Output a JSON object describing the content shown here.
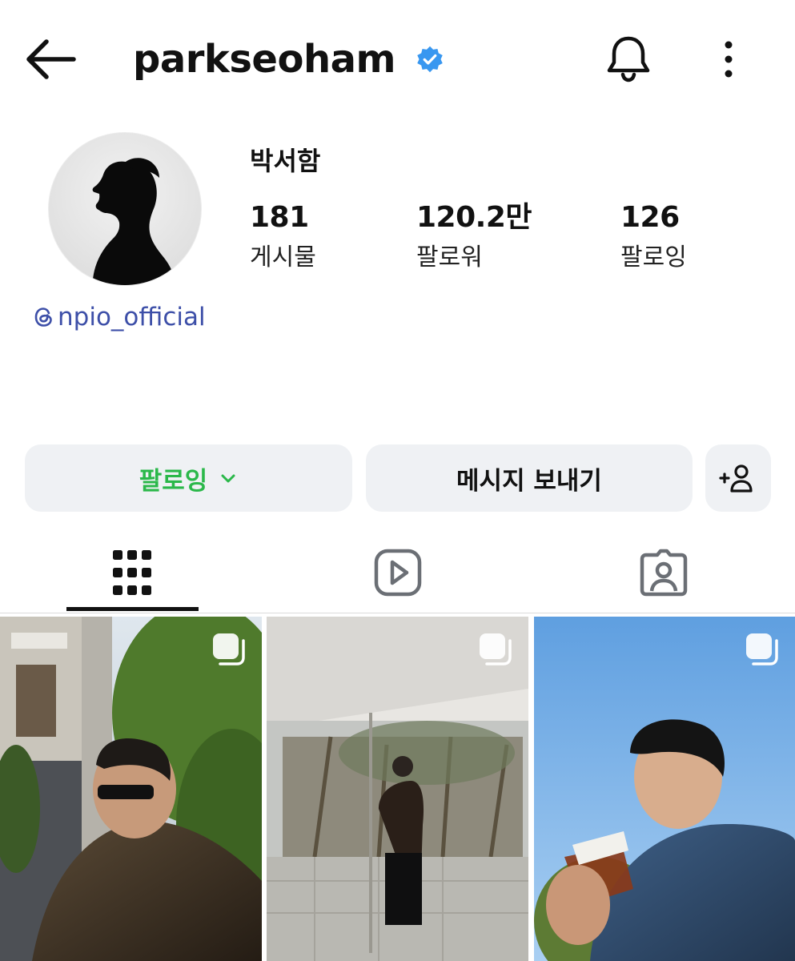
{
  "header": {
    "username": "parkseoham",
    "icons": {
      "back": "arrow-left-icon",
      "verified": "verified-badge-icon",
      "notifications": "bell-icon",
      "more": "more-vertical-icon"
    },
    "colors": {
      "verified": "#3897f0"
    }
  },
  "profile": {
    "display_name": "박서함",
    "avatar": "profile-silhouette-avatar",
    "stats": [
      {
        "value": "181",
        "label": "게시물"
      },
      {
        "value": "120.2만",
        "label": "팔로워"
      },
      {
        "value": "126",
        "label": "팔로잉"
      }
    ],
    "threads_handle": "npio_official",
    "colors": {
      "link": "#3d4fa8"
    }
  },
  "actions": {
    "following_label": "팔로잉",
    "message_label": "메시지 보내기",
    "colors": {
      "following_text": "#2bb84a",
      "button_bg": "#eff1f4"
    },
    "icons": {
      "following_chevron": "chevron-down-icon",
      "add_user": "add-user-icon"
    }
  },
  "tabs": [
    {
      "name": "posts",
      "icon": "grid-icon",
      "active": true
    },
    {
      "name": "reels",
      "icon": "reels-play-icon",
      "active": false
    },
    {
      "name": "tagged",
      "icon": "tagged-person-icon",
      "active": false
    }
  ],
  "grid": [
    {
      "type": "carousel",
      "icon": "carousel-icon",
      "description": "man in sunglasses and leather jacket by a pole"
    },
    {
      "type": "carousel",
      "icon": "carousel-icon",
      "description": "man in suit standing by glass wall courtyard"
    },
    {
      "type": "carousel",
      "icon": "carousel-icon",
      "description": "man in denim shirt drinking iced tea under blue sky"
    }
  ]
}
